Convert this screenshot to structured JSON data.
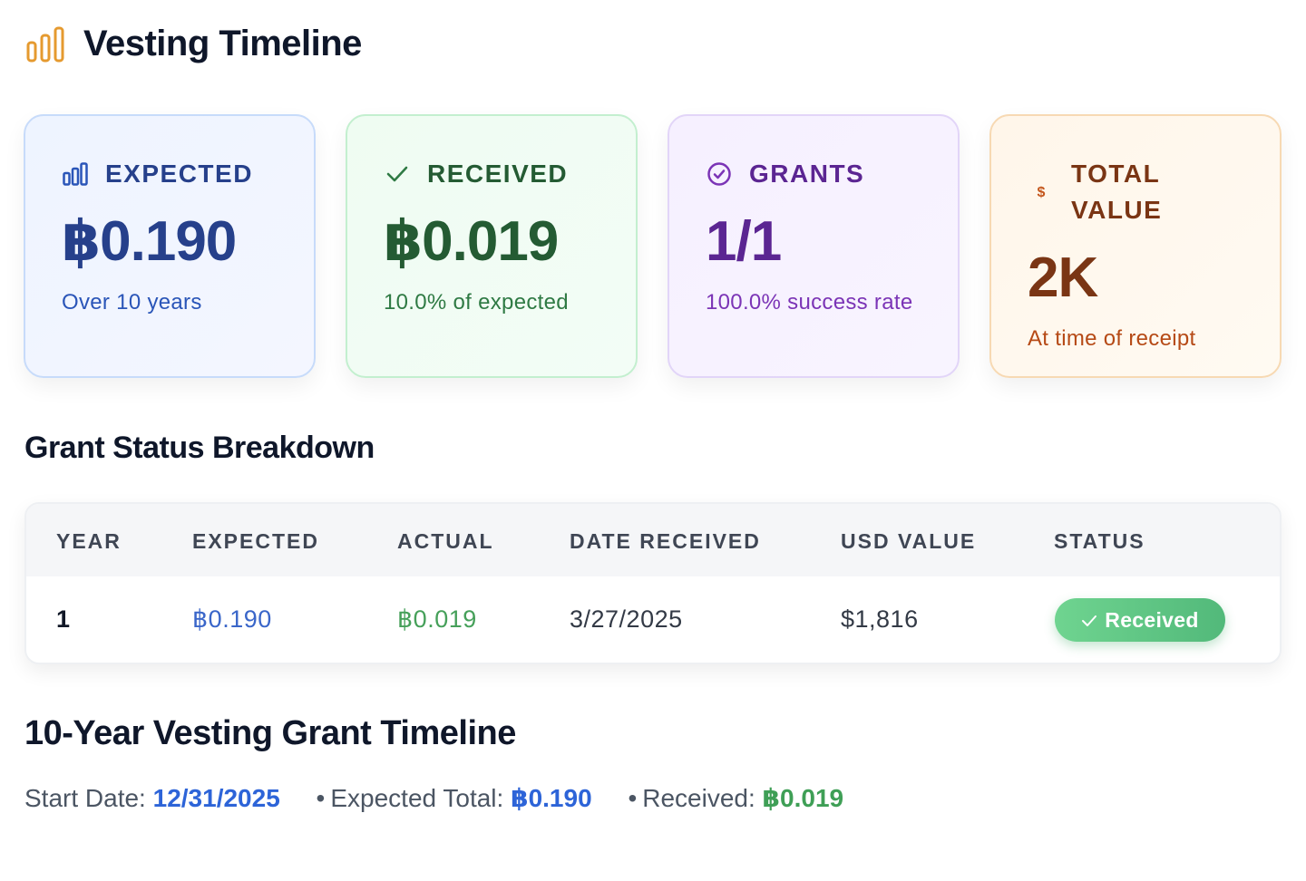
{
  "header": {
    "title": "Vesting Timeline",
    "icon": "bar-chart-icon",
    "icon_color": "#e59a2f"
  },
  "cards": [
    {
      "id": "expected",
      "label": "EXPECTED",
      "value": "฿0.190",
      "sub": "Over 10 years",
      "icon": "bar-chart-icon",
      "accent": "#26408b"
    },
    {
      "id": "received",
      "label": "RECEIVED",
      "value": "฿0.019",
      "sub": "10.0% of expected",
      "icon": "check-icon",
      "accent": "#245b33"
    },
    {
      "id": "grants",
      "label": "GRANTS",
      "value": "1/1",
      "sub": "100.0% success rate",
      "icon": "check-circle-icon",
      "accent": "#5b2592"
    },
    {
      "id": "total",
      "label": "TOTAL VALUE",
      "value": "2K",
      "sub": "At time of receipt",
      "icon": "dollar-icon",
      "accent": "#7a3514"
    }
  ],
  "breakdown": {
    "title": "Grant Status Breakdown",
    "columns": [
      "YEAR",
      "EXPECTED",
      "ACTUAL",
      "DATE RECEIVED",
      "USD VALUE",
      "STATUS"
    ],
    "rows": [
      {
        "year": "1",
        "expected": "฿0.190",
        "actual": "฿0.019",
        "date": "3/27/2025",
        "usd": "$1,816",
        "status": "Received"
      }
    ]
  },
  "timeline": {
    "title": "10-Year Vesting Grant Timeline",
    "start_label": "Start Date:",
    "start_value": "12/31/2025",
    "expected_label": "Expected Total:",
    "expected_value": "฿0.190",
    "received_label": "Received:",
    "received_value": "฿0.019"
  },
  "colors": {
    "status_received": "#52b97a",
    "link_blue": "#2d64d8",
    "value_green": "#3f9f56"
  }
}
